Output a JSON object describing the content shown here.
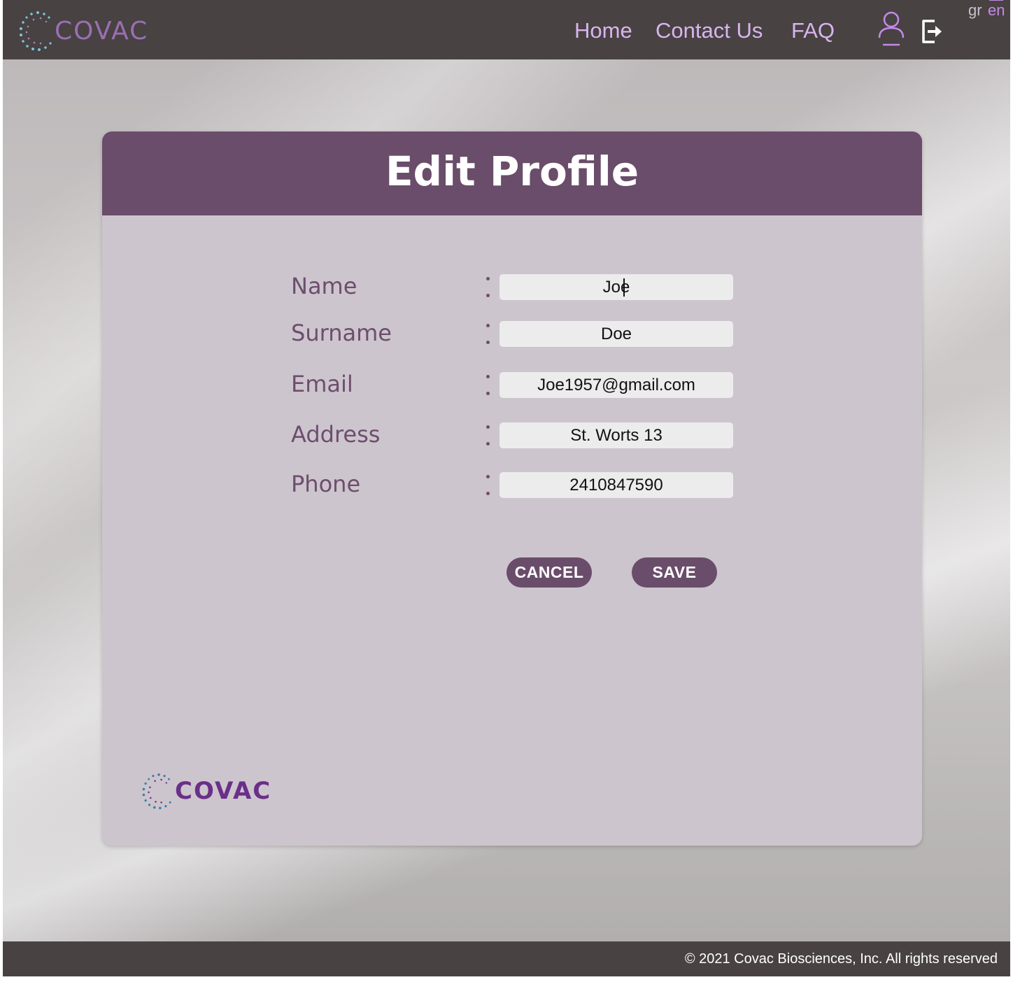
{
  "header": {
    "logo_text": "COVAC",
    "nav": [
      "Home",
      "Contact Us",
      "FAQ"
    ],
    "languages": [
      "gr",
      "en"
    ],
    "active_language": "en"
  },
  "card": {
    "title": "Edit Profile",
    "fields": [
      {
        "label": "Name",
        "value": "Joe"
      },
      {
        "label": "Surname",
        "value": "Doe"
      },
      {
        "label": "Email",
        "value": "Joe1957@gmail.com"
      },
      {
        "label": "Address",
        "value": "St. Worts 13"
      },
      {
        "label": "Phone",
        "value": "2410847590"
      }
    ],
    "buttons": {
      "cancel": "CANCEL",
      "save": "SAVE"
    },
    "footer_logo_text": "COVAC"
  },
  "footer": {
    "copyright": "© 2021 Covac Biosciences, Inc. All rights reserved"
  },
  "colors": {
    "topbar": "#484243",
    "accent": "#6a4d6a",
    "nav_text": "#d8b5ee",
    "card_bg": "#cdc5cd"
  }
}
